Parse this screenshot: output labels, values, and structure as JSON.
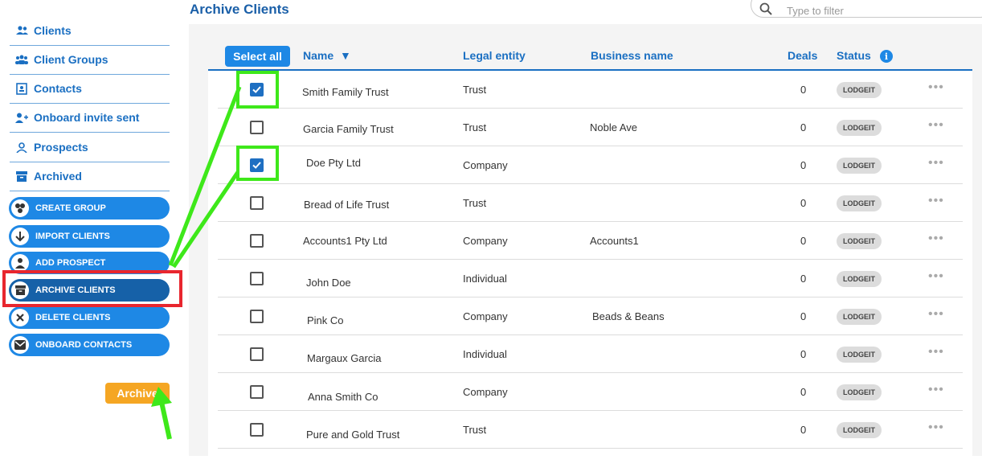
{
  "page": {
    "title": "Archive Clients"
  },
  "search": {
    "placeholder": "Type to filter"
  },
  "sidebar": {
    "items": [
      {
        "label": "Clients",
        "icon": "users-icon"
      },
      {
        "label": "Client Groups",
        "icon": "group-icon"
      },
      {
        "label": "Contacts",
        "icon": "contact-card-icon"
      },
      {
        "label": "Onboard invite sent",
        "icon": "user-add-icon"
      },
      {
        "label": "Prospects",
        "icon": "prospect-icon"
      },
      {
        "label": "Archived",
        "icon": "archive-box-icon"
      }
    ],
    "actions": [
      {
        "label": "CREATE GROUP",
        "icon": "group-circles-icon"
      },
      {
        "label": "IMPORT CLIENTS",
        "icon": "download-arrow-icon"
      },
      {
        "label": "ADD PROSPECT",
        "icon": "person-icon"
      },
      {
        "label": "ARCHIVE CLIENTS",
        "icon": "archive-box-icon",
        "active": true
      },
      {
        "label": "DELETE CLIENTS",
        "icon": "close-icon"
      },
      {
        "label": "ONBOARD CONTACTS",
        "icon": "mail-icon"
      }
    ],
    "archive_button": "Archive"
  },
  "table": {
    "select_all": "Select all",
    "columns": {
      "name": "Name",
      "legal_entity": "Legal entity",
      "business_name": "Business name",
      "deals": "Deals",
      "status": "Status"
    },
    "sort_indicator": "▼",
    "rows": [
      {
        "name": "Smith Family Trust",
        "legal_entity": "Trust",
        "business_name": "",
        "deals": "0",
        "status": "LODGEIT",
        "checked": true
      },
      {
        "name": "Garcia Family Trust",
        "legal_entity": "Trust",
        "business_name": "Noble Ave",
        "deals": "0",
        "status": "LODGEIT",
        "checked": false
      },
      {
        "name": "Doe Pty Ltd",
        "legal_entity": "Company",
        "business_name": "",
        "deals": "0",
        "status": "LODGEIT",
        "checked": true
      },
      {
        "name": "Bread of Life Trust",
        "legal_entity": "Trust",
        "business_name": "",
        "deals": "0",
        "status": "LODGEIT",
        "checked": false
      },
      {
        "name": "Accounts1 Pty Ltd",
        "legal_entity": "Company",
        "business_name": "Accounts1",
        "deals": "0",
        "status": "LODGEIT",
        "checked": false
      },
      {
        "name": "John Doe",
        "legal_entity": "Individual",
        "business_name": "",
        "deals": "0",
        "status": "LODGEIT",
        "checked": false
      },
      {
        "name": "Pink Co",
        "legal_entity": "Company",
        "business_name": "Beads & Beans",
        "deals": "0",
        "status": "LODGEIT",
        "checked": false
      },
      {
        "name": "Margaux Garcia",
        "legal_entity": "Individual",
        "business_name": "",
        "deals": "0",
        "status": "LODGEIT",
        "checked": false
      },
      {
        "name": "Anna Smith Co",
        "legal_entity": "Company",
        "business_name": "",
        "deals": "0",
        "status": "LODGEIT",
        "checked": false
      },
      {
        "name": "Pure and Gold Trust",
        "legal_entity": "Trust",
        "business_name": "",
        "deals": "0",
        "status": "LODGEIT",
        "checked": false
      }
    ]
  },
  "colors": {
    "accent": "#1a6fc2",
    "highlight_green": "#3ee81a",
    "highlight_red": "#e8262e",
    "archive_orange": "#f5a623"
  }
}
